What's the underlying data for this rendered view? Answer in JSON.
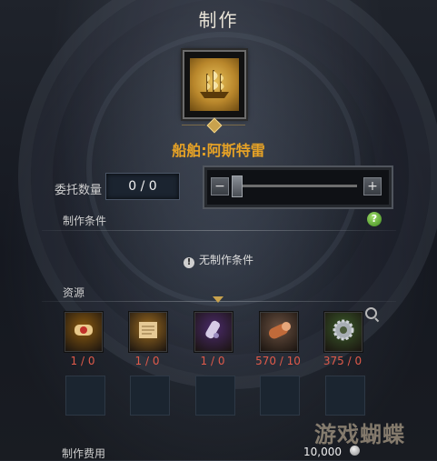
{
  "window": {
    "title": "制作"
  },
  "item": {
    "name": "船舶:阿斯特雷",
    "icon": "ship-icon",
    "icon_color": "#c9962f"
  },
  "quantity": {
    "label": "委托数量",
    "value": "0 / 0",
    "minus": "−",
    "plus": "+",
    "slider_level": 0
  },
  "conditions": {
    "label": "制作条件",
    "help": "?",
    "empty_text": "无制作条件",
    "info": "!"
  },
  "resources": {
    "label": "资源",
    "items": [
      {
        "icon": "scroll-icon",
        "count": "1 / 0",
        "bg": "#8a5a10"
      },
      {
        "icon": "parchment-icon",
        "count": "1 / 0",
        "bg": "#9a6a20"
      },
      {
        "icon": "blueprint-icon",
        "count": "1 / 0",
        "bg": "#4a2a6a"
      },
      {
        "icon": "timber-icon",
        "count": "570 / 10",
        "bg": "#6a5040"
      },
      {
        "icon": "gear-icon",
        "count": "375 / 0",
        "bg": "#3a5a2a"
      }
    ]
  },
  "fee": {
    "label": "制作费用",
    "value": "10,000",
    "currency_icon": "silver-coin-icon"
  },
  "watermark": "游戏蝴蝶"
}
